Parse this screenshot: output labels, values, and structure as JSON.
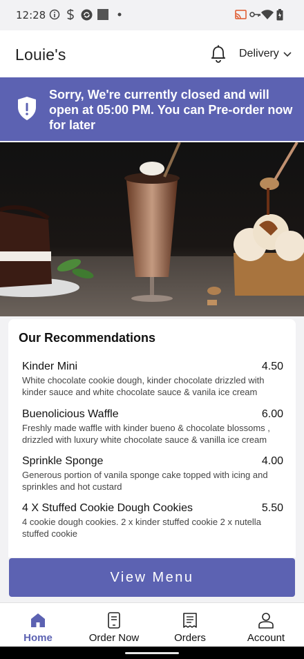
{
  "status_bar": {
    "time": "12:28",
    "icons": [
      "info-circle-icon",
      "s-coin-icon",
      "sync-icon",
      "square-icon",
      "dot-icon",
      "cast-icon",
      "key-icon",
      "wifi-icon",
      "battery-icon"
    ]
  },
  "header": {
    "title": "Louie's",
    "notification_icon": "bell-icon",
    "delivery_label": "Delivery",
    "dropdown_icon": "chevron-down-icon"
  },
  "banner": {
    "icon": "shield-alert-icon",
    "message": "Sorry, We're currently closed and will open at 05:00 PM. You can Pre-order now for later",
    "color": "#5c62b2"
  },
  "recommendations": {
    "heading": "Our Recommendations",
    "items": [
      {
        "name": "Kinder Mini",
        "price": "4.50",
        "description": "White chocolate cookie dough, kinder chocolate drizzled with kinder sauce and white chocolate sauce & vanila ice cream"
      },
      {
        "name": "Buenolicious Waffle",
        "price": "6.00",
        "description": "Freshly made waffle with kinder bueno & chocolate blossoms , drizzled with luxury white chocolate sauce & vanilla ice cream"
      },
      {
        "name": "Sprinkle Sponge",
        "price": "4.00",
        "description": "Generous portion of vanila sponge cake topped with icing and sprinkles and hot custard"
      },
      {
        "name": "4 X Stuffed Cookie Dough Cookies",
        "price": "5.50",
        "description": "4 cookie dough cookies. 2 x kinder stuffed cookie  2 x nutella stuffed cookie"
      }
    ]
  },
  "view_menu_label": "View Menu",
  "bottom_nav": [
    {
      "label": "Home",
      "icon": "home-icon",
      "active": true
    },
    {
      "label": "Order Now",
      "icon": "phone-order-icon",
      "active": false
    },
    {
      "label": "Orders",
      "icon": "receipt-icon",
      "active": false
    },
    {
      "label": "Account",
      "icon": "user-icon",
      "active": false
    }
  ],
  "accent_color": "#5c62b2"
}
